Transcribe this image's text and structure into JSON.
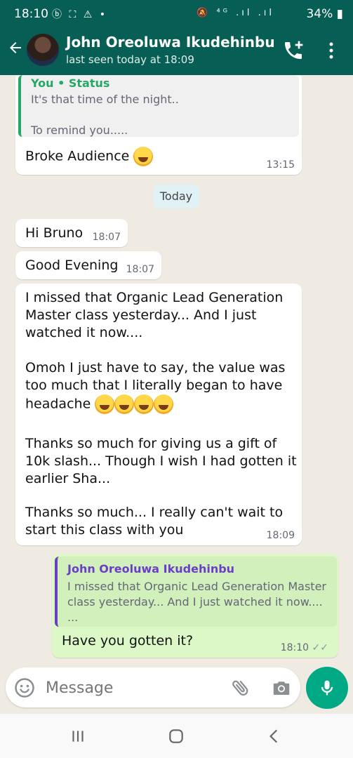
{
  "status_bar": {
    "time": "18:10",
    "left_icons": "ⓑ ⛶ ⚠ •",
    "right_icons": "🔕 ⁴ᴳ .ıl .ıl",
    "battery": "34%"
  },
  "header": {
    "contact_name": "John Oreoluwa Ikudehinbu",
    "last_seen": "last seen today at 18:09"
  },
  "messages": {
    "m1": {
      "quote_author": "You • Status",
      "quote_line1": "It's that time of the night..",
      "quote_line2": "To remind you.....",
      "text": "Broke Audience",
      "time": "13:15"
    },
    "date_chip": "Today",
    "m2": {
      "text": "Hi Bruno",
      "time": "18:07"
    },
    "m3": {
      "text": "Good Evening",
      "time": "18:07"
    },
    "m4": {
      "p1": "I missed that Organic Lead Generation\nMaster class yesterday... And I just\nwatched it now....",
      "p2": "Omoh I just have to say, the value was\ntoo much that I literally began to have\nheadache",
      "p3": "Thanks so much for giving us a gift of\n10k slash... Though I wish I had gotten it\nearlier Sha...",
      "p4": "Thanks so much... I really can't wait to\nstart this class with you",
      "time": "18:09"
    },
    "m5": {
      "quote_author": "John Oreoluwa Ikudehinbu",
      "quote_text": "I missed that Organic Lead Generation Master\nclass yesterday... And I just watched it now....\n...",
      "text": "Have you gotten it?",
      "time": "18:10"
    }
  },
  "composer": {
    "placeholder": "Message"
  },
  "colors": {
    "header": "#075e54",
    "outgoing": "#dcf8c6",
    "accent": "#00a884"
  },
  "icons": [
    "back-arrow-icon",
    "add-call-icon",
    "more-vert-icon",
    "emoji-icon",
    "attach-icon",
    "camera-icon",
    "mic-icon",
    "recents-icon",
    "home-icon",
    "back-icon"
  ]
}
